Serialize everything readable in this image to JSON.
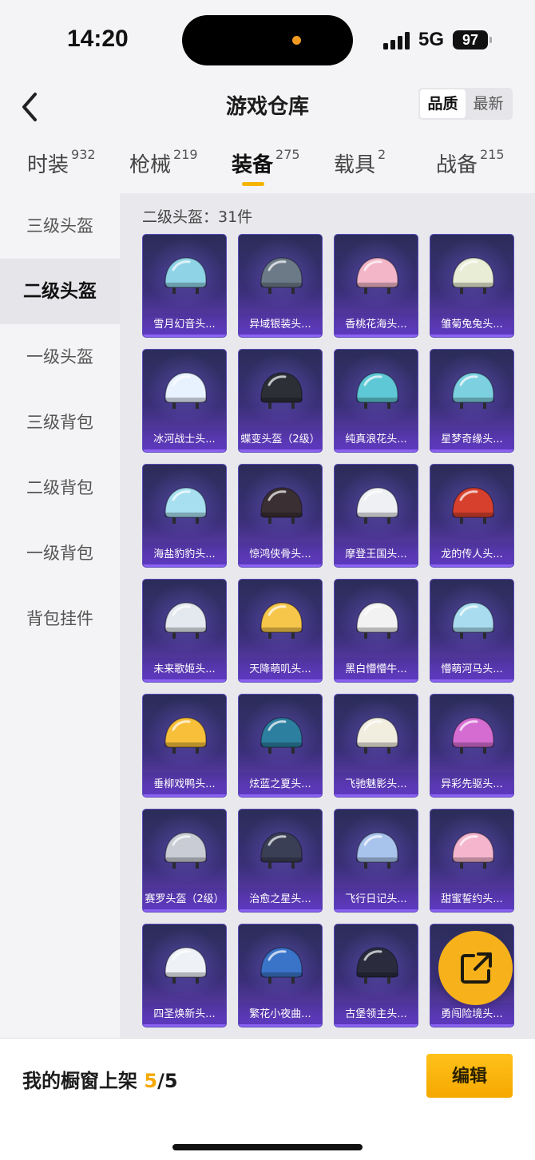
{
  "status_bar": {
    "time": "14:20",
    "network": "5G",
    "battery": "97"
  },
  "nav": {
    "title": "游戏仓库",
    "sort_options": [
      "品质",
      "最新"
    ],
    "sort_active": "品质"
  },
  "tabs": [
    {
      "label": "时装",
      "count": "932"
    },
    {
      "label": "枪械",
      "count": "219"
    },
    {
      "label": "装备",
      "count": "275"
    },
    {
      "label": "载具",
      "count": "2"
    },
    {
      "label": "战备",
      "count": "215"
    }
  ],
  "active_tab": "装备",
  "sidebar": {
    "items": [
      "三级头盔",
      "二级头盔",
      "一级头盔",
      "三级背包",
      "二级背包",
      "一级背包",
      "背包挂件"
    ],
    "active": "二级头盔"
  },
  "section": {
    "title": "二级头盔：31件"
  },
  "items": [
    {
      "name": "雪月幻音头...",
      "color": "#8fd3e6"
    },
    {
      "name": "异域银装头...",
      "color": "#6c7a88"
    },
    {
      "name": "香桃花海头...",
      "color": "#f2b6c8"
    },
    {
      "name": "雏菊兔兔头...",
      "color": "#e9edd6"
    },
    {
      "name": "冰河战士头...",
      "color": "#e8f2ff"
    },
    {
      "name": "蝶变头盔（2级）",
      "color": "#2c2f36"
    },
    {
      "name": "纯真浪花头...",
      "color": "#5ec8d6"
    },
    {
      "name": "星梦奇缘头...",
      "color": "#7cd0e0"
    },
    {
      "name": "海盐豹豹头...",
      "color": "#a7dff0"
    },
    {
      "name": "惊鸿侠骨头...",
      "color": "#3a2f33"
    },
    {
      "name": "摩登王国头...",
      "color": "#eef0f4"
    },
    {
      "name": "龙的传人头...",
      "color": "#d8402e"
    },
    {
      "name": "未来歌姬头...",
      "color": "#e4e8ef"
    },
    {
      "name": "天降萌叽头...",
      "color": "#f6c64a"
    },
    {
      "name": "黑白懵懵牛...",
      "color": "#f2f2f2"
    },
    {
      "name": "懵萌河马头...",
      "color": "#a9dcef"
    },
    {
      "name": "垂柳戏鸭头...",
      "color": "#f7bf3a"
    },
    {
      "name": "炫蓝之夏头...",
      "color": "#2d7fa0"
    },
    {
      "name": "飞驰魅影头...",
      "color": "#f1eee0"
    },
    {
      "name": "异彩先驱头...",
      "color": "#d56cd2"
    },
    {
      "name": "赛罗头盔（2级）",
      "color": "#c9ccd4"
    },
    {
      "name": "治愈之星头...",
      "color": "#3b3f55"
    },
    {
      "name": "飞行日记头...",
      "color": "#a9c4ec"
    },
    {
      "name": "甜蜜誓约头...",
      "color": "#f4b5cd"
    },
    {
      "name": "四圣焕新头...",
      "color": "#eef1f6"
    },
    {
      "name": "繁花小夜曲...",
      "color": "#3a74c8"
    },
    {
      "name": "古堡领主头...",
      "color": "#2a2c3e"
    },
    {
      "name": "勇闯险境头...",
      "color": "#c8c8d0"
    }
  ],
  "bottom": {
    "showcase_label": "我的橱窗上架",
    "current": "5",
    "total": "/5",
    "edit_label": "编辑"
  },
  "icons": {
    "back": "back-chevron-icon",
    "share": "share-external-icon"
  },
  "colors": {
    "accent": "#f5b400",
    "card_top": "#2b2d59",
    "card_bottom": "#6a3fc1"
  }
}
